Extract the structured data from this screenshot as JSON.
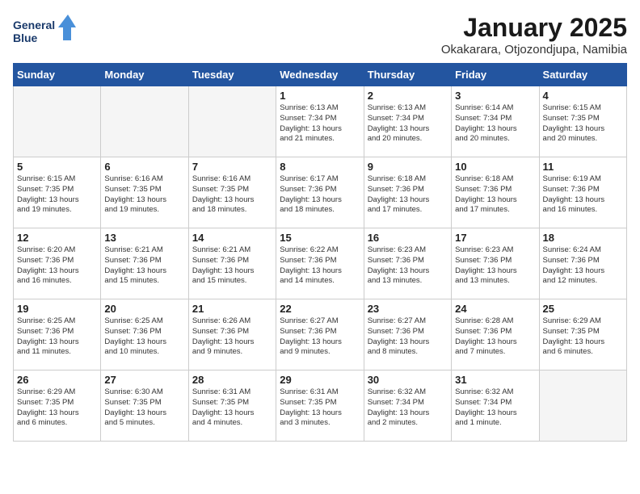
{
  "header": {
    "logo_line1": "General",
    "logo_line2": "Blue",
    "title": "January 2025",
    "subtitle": "Okakarara, Otjozondjupa, Namibia"
  },
  "days_of_week": [
    "Sunday",
    "Monday",
    "Tuesday",
    "Wednesday",
    "Thursday",
    "Friday",
    "Saturday"
  ],
  "weeks": [
    [
      {
        "day": "",
        "info": ""
      },
      {
        "day": "",
        "info": ""
      },
      {
        "day": "",
        "info": ""
      },
      {
        "day": "1",
        "info": "Sunrise: 6:13 AM\nSunset: 7:34 PM\nDaylight: 13 hours\nand 21 minutes."
      },
      {
        "day": "2",
        "info": "Sunrise: 6:13 AM\nSunset: 7:34 PM\nDaylight: 13 hours\nand 20 minutes."
      },
      {
        "day": "3",
        "info": "Sunrise: 6:14 AM\nSunset: 7:34 PM\nDaylight: 13 hours\nand 20 minutes."
      },
      {
        "day": "4",
        "info": "Sunrise: 6:15 AM\nSunset: 7:35 PM\nDaylight: 13 hours\nand 20 minutes."
      }
    ],
    [
      {
        "day": "5",
        "info": "Sunrise: 6:15 AM\nSunset: 7:35 PM\nDaylight: 13 hours\nand 19 minutes."
      },
      {
        "day": "6",
        "info": "Sunrise: 6:16 AM\nSunset: 7:35 PM\nDaylight: 13 hours\nand 19 minutes."
      },
      {
        "day": "7",
        "info": "Sunrise: 6:16 AM\nSunset: 7:35 PM\nDaylight: 13 hours\nand 18 minutes."
      },
      {
        "day": "8",
        "info": "Sunrise: 6:17 AM\nSunset: 7:36 PM\nDaylight: 13 hours\nand 18 minutes."
      },
      {
        "day": "9",
        "info": "Sunrise: 6:18 AM\nSunset: 7:36 PM\nDaylight: 13 hours\nand 17 minutes."
      },
      {
        "day": "10",
        "info": "Sunrise: 6:18 AM\nSunset: 7:36 PM\nDaylight: 13 hours\nand 17 minutes."
      },
      {
        "day": "11",
        "info": "Sunrise: 6:19 AM\nSunset: 7:36 PM\nDaylight: 13 hours\nand 16 minutes."
      }
    ],
    [
      {
        "day": "12",
        "info": "Sunrise: 6:20 AM\nSunset: 7:36 PM\nDaylight: 13 hours\nand 16 minutes."
      },
      {
        "day": "13",
        "info": "Sunrise: 6:21 AM\nSunset: 7:36 PM\nDaylight: 13 hours\nand 15 minutes."
      },
      {
        "day": "14",
        "info": "Sunrise: 6:21 AM\nSunset: 7:36 PM\nDaylight: 13 hours\nand 15 minutes."
      },
      {
        "day": "15",
        "info": "Sunrise: 6:22 AM\nSunset: 7:36 PM\nDaylight: 13 hours\nand 14 minutes."
      },
      {
        "day": "16",
        "info": "Sunrise: 6:23 AM\nSunset: 7:36 PM\nDaylight: 13 hours\nand 13 minutes."
      },
      {
        "day": "17",
        "info": "Sunrise: 6:23 AM\nSunset: 7:36 PM\nDaylight: 13 hours\nand 13 minutes."
      },
      {
        "day": "18",
        "info": "Sunrise: 6:24 AM\nSunset: 7:36 PM\nDaylight: 13 hours\nand 12 minutes."
      }
    ],
    [
      {
        "day": "19",
        "info": "Sunrise: 6:25 AM\nSunset: 7:36 PM\nDaylight: 13 hours\nand 11 minutes."
      },
      {
        "day": "20",
        "info": "Sunrise: 6:25 AM\nSunset: 7:36 PM\nDaylight: 13 hours\nand 10 minutes."
      },
      {
        "day": "21",
        "info": "Sunrise: 6:26 AM\nSunset: 7:36 PM\nDaylight: 13 hours\nand 9 minutes."
      },
      {
        "day": "22",
        "info": "Sunrise: 6:27 AM\nSunset: 7:36 PM\nDaylight: 13 hours\nand 9 minutes."
      },
      {
        "day": "23",
        "info": "Sunrise: 6:27 AM\nSunset: 7:36 PM\nDaylight: 13 hours\nand 8 minutes."
      },
      {
        "day": "24",
        "info": "Sunrise: 6:28 AM\nSunset: 7:36 PM\nDaylight: 13 hours\nand 7 minutes."
      },
      {
        "day": "25",
        "info": "Sunrise: 6:29 AM\nSunset: 7:35 PM\nDaylight: 13 hours\nand 6 minutes."
      }
    ],
    [
      {
        "day": "26",
        "info": "Sunrise: 6:29 AM\nSunset: 7:35 PM\nDaylight: 13 hours\nand 6 minutes."
      },
      {
        "day": "27",
        "info": "Sunrise: 6:30 AM\nSunset: 7:35 PM\nDaylight: 13 hours\nand 5 minutes."
      },
      {
        "day": "28",
        "info": "Sunrise: 6:31 AM\nSunset: 7:35 PM\nDaylight: 13 hours\nand 4 minutes."
      },
      {
        "day": "29",
        "info": "Sunrise: 6:31 AM\nSunset: 7:35 PM\nDaylight: 13 hours\nand 3 minutes."
      },
      {
        "day": "30",
        "info": "Sunrise: 6:32 AM\nSunset: 7:34 PM\nDaylight: 13 hours\nand 2 minutes."
      },
      {
        "day": "31",
        "info": "Sunrise: 6:32 AM\nSunset: 7:34 PM\nDaylight: 13 hours\nand 1 minute."
      },
      {
        "day": "",
        "info": ""
      }
    ]
  ]
}
